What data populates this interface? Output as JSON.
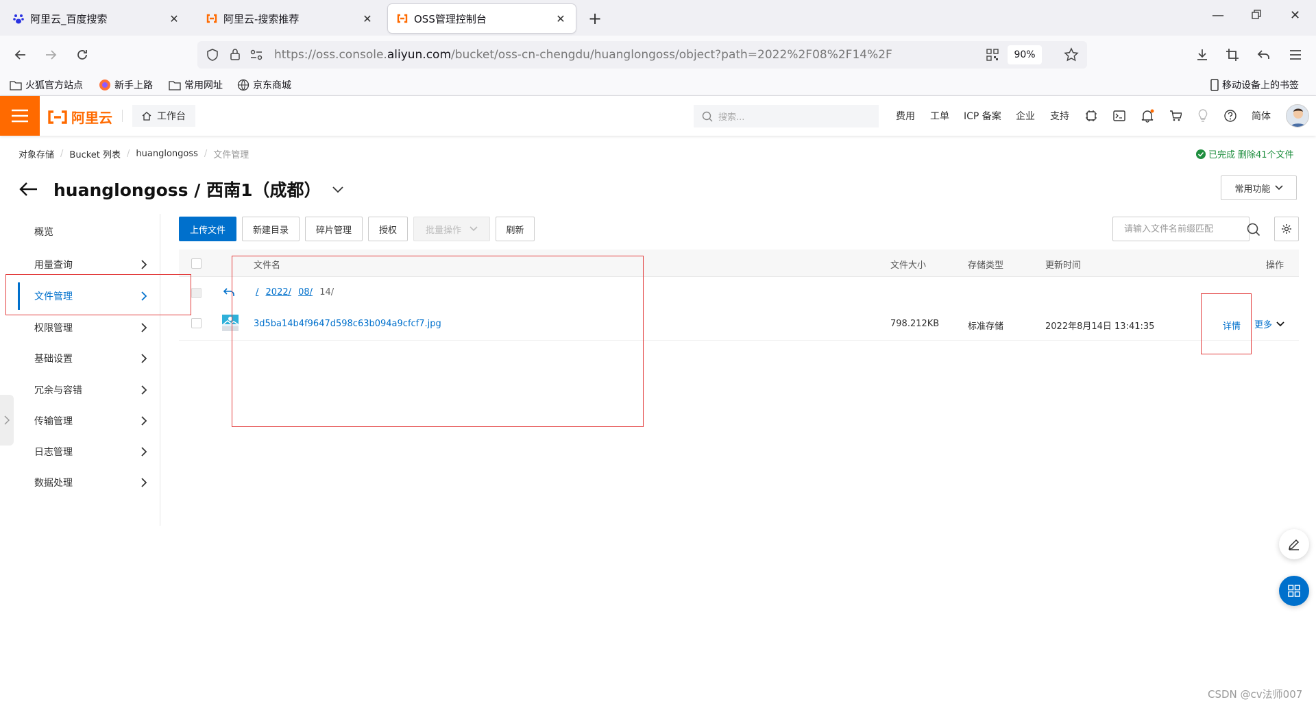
{
  "browser": {
    "tabs": [
      {
        "title": "阿里云_百度搜索",
        "icon": "baidu-paw-icon",
        "active": false
      },
      {
        "title": "阿里云-搜索推荐",
        "icon": "aliyun-logo-icon",
        "active": false
      },
      {
        "title": "OSS管理控制台",
        "icon": "aliyun-logo-icon",
        "active": true
      }
    ],
    "url_prefix": "https://oss.console.",
    "url_domain": "aliyun.com",
    "url_path": "/bucket/oss-cn-chengdu/huanglongoss/object?path=2022%2F08%2F14%2F",
    "zoom": "90%",
    "bookmarks": [
      "火狐官方站点",
      "新手上路",
      "常用网址",
      "京东商城"
    ],
    "mobile_bookmarks": "移动设备上的书签"
  },
  "console": {
    "logo_text": "阿里云",
    "workbench": "工作台",
    "search_placeholder": "搜索...",
    "nav": [
      "费用",
      "工单",
      "ICP 备案",
      "企业",
      "支持"
    ],
    "language": "简体",
    "brand_color": "#ff6a00",
    "accent_color": "#0070cc"
  },
  "breadcrumb": [
    "对象存储",
    "Bucket 列表",
    "huanglongoss",
    "文件管理"
  ],
  "status": {
    "done": "已完成",
    "text": "删除41个文件"
  },
  "title": "huanglongoss / 西南1（成都）",
  "common_functions": "常用功能",
  "menu": [
    {
      "label": "概览",
      "chevron": false
    },
    {
      "label": "用量查询",
      "chevron": true
    },
    {
      "label": "文件管理",
      "chevron": true,
      "active": true
    },
    {
      "label": "权限管理",
      "chevron": true
    },
    {
      "label": "基础设置",
      "chevron": true
    },
    {
      "label": "冗余与容错",
      "chevron": true
    },
    {
      "label": "传输管理",
      "chevron": true
    },
    {
      "label": "日志管理",
      "chevron": true
    },
    {
      "label": "数据处理",
      "chevron": true
    }
  ],
  "toolbar": {
    "upload": "上传文件",
    "new_dir": "新建目录",
    "fragments": "碎片管理",
    "authorize": "授权",
    "batch": "批量操作",
    "refresh": "刷新",
    "search_placeholder": "请输入文件名前缀匹配"
  },
  "table": {
    "headers": {
      "name": "文件名",
      "size": "文件大小",
      "storage": "存储类型",
      "updated": "更新时间",
      "actions": "操作"
    },
    "path": {
      "root": "/",
      "year": "2022/",
      "month": "08/",
      "day": "14/"
    },
    "rows": [
      {
        "name": "3d5ba14b4f9647d598c63b094a9cfcf7.jpg",
        "size": "798.212KB",
        "storage": "标准存储",
        "updated": "2022年8月14日 13:41:35",
        "detail": "详情",
        "more": "更多"
      }
    ]
  },
  "watermark": "CSDN @cv法师007"
}
